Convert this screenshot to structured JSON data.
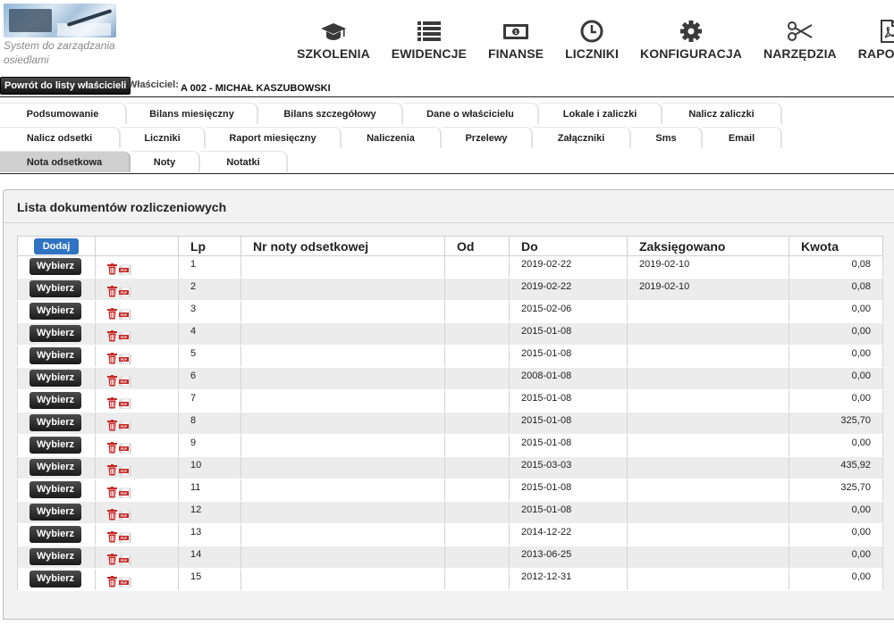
{
  "app": {
    "tagline": "System do zarządzania osiedlami"
  },
  "topnav": [
    {
      "label": "SZKOLENIA",
      "icon": "graduation-cap-icon"
    },
    {
      "label": "EWIDENCJE",
      "icon": "list-icon"
    },
    {
      "label": "FINANSE",
      "icon": "banknote-icon"
    },
    {
      "label": "LICZNIKI",
      "icon": "clock-icon"
    },
    {
      "label": "KONFIGURACJA",
      "icon": "gear-icon"
    },
    {
      "label": "NARZĘDZIA",
      "icon": "scissors-icon"
    },
    {
      "label": "RAPORTY",
      "icon": "pdf-file-icon"
    }
  ],
  "owner": {
    "back_label": "Powrót do listy właścicieli",
    "label": "Właściciel:",
    "value": "A 002 - MICHAŁ KASZUBOWSKI"
  },
  "tabs": {
    "row1": [
      "Podsumowanie",
      "Bilans miesięczny",
      "Bilans szczegółowy",
      "Dane o właścicielu",
      "Lokale i zaliczki",
      "Nalicz zaliczki"
    ],
    "row2": [
      "Nalicz odsetki",
      "Liczniki",
      "Raport miesięczny",
      "Naliczenia",
      "Przelewy",
      "Załączniki",
      "Sms",
      "Email"
    ],
    "row3": [
      "Nota odsetkowa",
      "Noty",
      "Notatki"
    ],
    "active": "Nota odsetkowa"
  },
  "panel": {
    "title": "Lista dokumentów rozliczeniowych"
  },
  "table": {
    "add_label": "Dodaj",
    "select_label": "Wybierz",
    "headers": [
      "Lp",
      "Nr noty odsetkowej",
      "Od",
      "Do",
      "Zaksięgowano",
      "Kwota"
    ],
    "rows": [
      {
        "lp": "1",
        "nr": "",
        "od": "",
        "do": "2019-02-22",
        "zaks": "2019-02-10",
        "kwota": "0,08"
      },
      {
        "lp": "2",
        "nr": "",
        "od": "",
        "do": "2019-02-22",
        "zaks": "2019-02-10",
        "kwota": "0,08"
      },
      {
        "lp": "3",
        "nr": "",
        "od": "",
        "do": "2015-02-06",
        "zaks": "",
        "kwota": "0,00"
      },
      {
        "lp": "4",
        "nr": "",
        "od": "",
        "do": "2015-01-08",
        "zaks": "",
        "kwota": "0,00"
      },
      {
        "lp": "5",
        "nr": "",
        "od": "",
        "do": "2015-01-08",
        "zaks": "",
        "kwota": "0,00"
      },
      {
        "lp": "6",
        "nr": "",
        "od": "",
        "do": "2008-01-08",
        "zaks": "",
        "kwota": "0,00"
      },
      {
        "lp": "7",
        "nr": "",
        "od": "",
        "do": "2015-01-08",
        "zaks": "",
        "kwota": "0,00"
      },
      {
        "lp": "8",
        "nr": "",
        "od": "",
        "do": "2015-01-08",
        "zaks": "",
        "kwota": "325,70"
      },
      {
        "lp": "9",
        "nr": "",
        "od": "",
        "do": "2015-01-08",
        "zaks": "",
        "kwota": "0,00"
      },
      {
        "lp": "10",
        "nr": "",
        "od": "",
        "do": "2015-03-03",
        "zaks": "",
        "kwota": "435,92"
      },
      {
        "lp": "11",
        "nr": "",
        "od": "",
        "do": "2015-01-08",
        "zaks": "",
        "kwota": "325,70"
      },
      {
        "lp": "12",
        "nr": "",
        "od": "",
        "do": "2015-01-08",
        "zaks": "",
        "kwota": "0,00"
      },
      {
        "lp": "13",
        "nr": "",
        "od": "",
        "do": "2014-12-22",
        "zaks": "",
        "kwota": "0,00"
      },
      {
        "lp": "14",
        "nr": "",
        "od": "",
        "do": "2013-06-25",
        "zaks": "",
        "kwota": "0,00"
      },
      {
        "lp": "15",
        "nr": "",
        "od": "",
        "do": "2012-12-31",
        "zaks": "",
        "kwota": "0,00"
      }
    ]
  }
}
